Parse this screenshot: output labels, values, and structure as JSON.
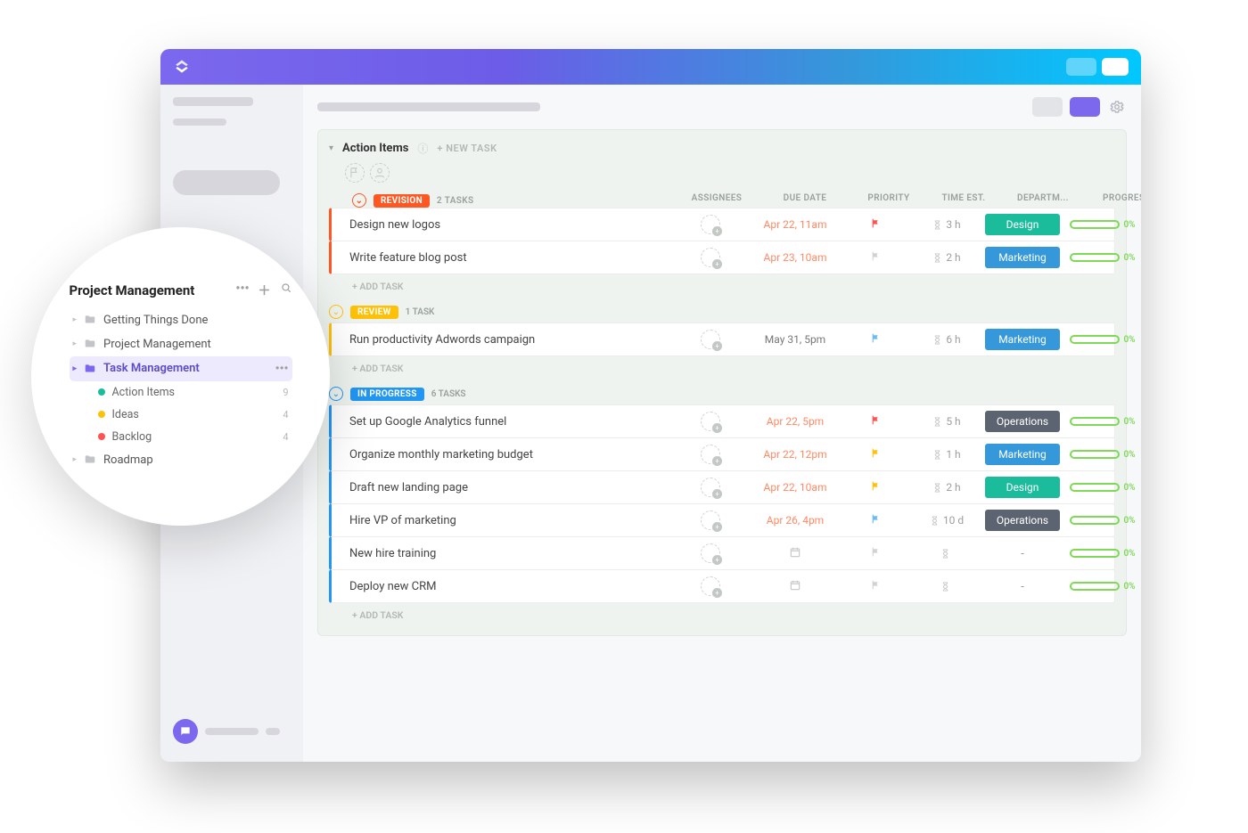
{
  "sidebar_bubble": {
    "title": "Project Management",
    "folders": [
      {
        "label": "Getting Things Done"
      },
      {
        "label": "Project Management"
      },
      {
        "label": "Task Management",
        "active": true
      },
      {
        "label": "Roadmap"
      }
    ],
    "lists": [
      {
        "label": "Action Items",
        "count": "9",
        "color": "#1abc9c"
      },
      {
        "label": "Ideas",
        "count": "4",
        "color": "#ffc107"
      },
      {
        "label": "Backlog",
        "count": "4",
        "color": "#ff5252"
      }
    ]
  },
  "panel": {
    "title": "Action Items",
    "new_task_label": "+ NEW TASK"
  },
  "columns": {
    "assignees": "ASSIGNEES",
    "due_date": "DUE DATE",
    "priority": "PRIORITY",
    "time_est": "TIME EST.",
    "department": "DEPARTM...",
    "progress": "PROGRESS"
  },
  "add_task_label": "+ ADD TASK",
  "groups": [
    {
      "status": "REVISION",
      "color": "#ff5722",
      "count_label": "2 TASKS",
      "tasks": [
        {
          "name": "Design new logos",
          "due": "Apr 22, 11am",
          "due_class": "due-warn",
          "flag": "flag-red",
          "time": "3 h",
          "dept": "Design",
          "dept_class": "dept-design",
          "progress": "0%"
        },
        {
          "name": "Write feature blog post",
          "due": "Apr 23, 10am",
          "due_class": "due-warn",
          "flag": "flag-grey",
          "time": "2 h",
          "dept": "Marketing",
          "dept_class": "dept-marketing",
          "progress": "0%"
        }
      ]
    },
    {
      "status": "REVIEW",
      "color": "#ffc107",
      "count_label": "1 TASK",
      "tasks": [
        {
          "name": "Run productivity Adwords campaign",
          "due": "May 31, 5pm",
          "due_class": "due-cold",
          "flag": "flag-blue",
          "time": "6 h",
          "dept": "Marketing",
          "dept_class": "dept-marketing",
          "progress": "0%"
        }
      ]
    },
    {
      "status": "IN PROGRESS",
      "color": "#2196f3",
      "count_label": "6 TASKS",
      "tasks": [
        {
          "name": "Set up Google Analytics funnel",
          "due": "Apr 22, 5pm",
          "due_class": "due-warn",
          "flag": "flag-red",
          "time": "5 h",
          "dept": "Operations",
          "dept_class": "dept-ops",
          "progress": "0%"
        },
        {
          "name": "Organize monthly marketing budget",
          "due": "Apr 22, 12pm",
          "due_class": "due-warn",
          "flag": "flag-yellow",
          "time": "1 h",
          "dept": "Marketing",
          "dept_class": "dept-marketing",
          "progress": "0%"
        },
        {
          "name": "Draft new landing page",
          "due": "Apr 22, 10am",
          "due_class": "due-warn",
          "flag": "flag-yellow",
          "time": "2 h",
          "dept": "Design",
          "dept_class": "dept-design",
          "progress": "0%"
        },
        {
          "name": "Hire VP of marketing",
          "due": "Apr 26, 4pm",
          "due_class": "due-warn",
          "flag": "flag-blue",
          "time": "10 d",
          "dept": "Operations",
          "dept_class": "dept-ops",
          "progress": "0%"
        },
        {
          "name": "New hire training",
          "due": "",
          "due_class": "due-empty",
          "flag": "flag-grey",
          "time": "",
          "dept": "-",
          "dept_class": "",
          "progress": "0%"
        },
        {
          "name": "Deploy new CRM",
          "due": "",
          "due_class": "due-empty",
          "flag": "flag-grey",
          "time": "",
          "dept": "-",
          "dept_class": "",
          "progress": "0%"
        }
      ]
    }
  ]
}
